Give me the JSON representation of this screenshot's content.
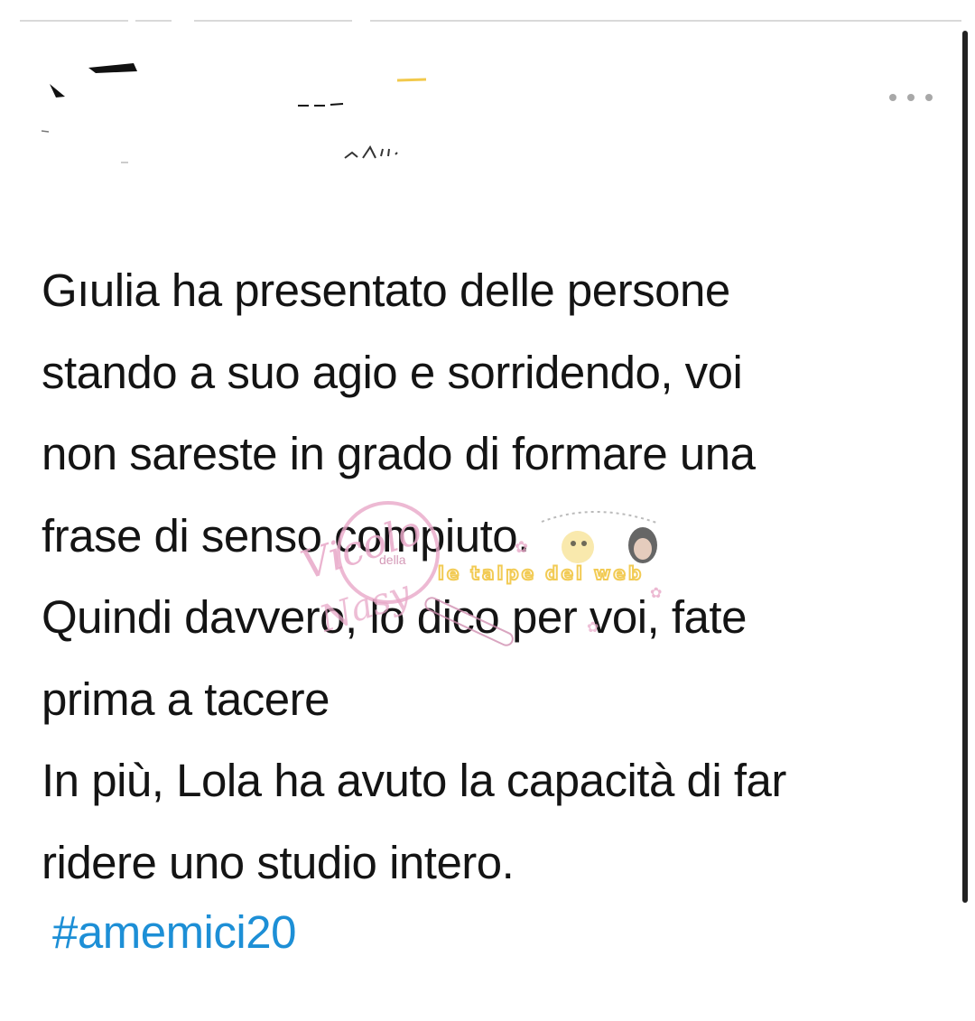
{
  "tweet": {
    "body_lines": [
      "Gıulia ha presentato delle persone",
      "stando a suo agio e sorridendo, voi",
      "non sareste in grado di formare una",
      "frase di senso compiuto.",
      "Quindi davvero, lo dico per voi, fate",
      "prima a tacere",
      "In più, Lola ha avuto la capacità di far",
      "ridere uno studio intero."
    ],
    "hashtag": "#amemici20"
  },
  "header": {
    "more_icon": "more-horizontal-icon",
    "user_info_obscured": true
  },
  "watermark": {
    "left_text": "Vicolo della Nasy",
    "right_text": "le talpe del web"
  },
  "colors": {
    "text": "#141414",
    "hashtag": "#1d8fd6",
    "scrollbar": "#222222",
    "more_dots": "#a8a8a8",
    "watermark_pink": "#e8a8c8",
    "watermark_yellow": "#f2c94c"
  }
}
